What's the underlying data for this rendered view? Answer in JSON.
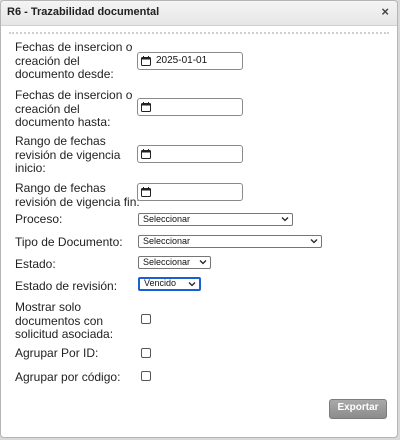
{
  "dialog": {
    "title": "R6 - Trazabilidad documental",
    "close_label": "×"
  },
  "fields": {
    "fecha_desde": {
      "label": "Fechas de insercion o creación del documento desde:",
      "value": "2025-01-01"
    },
    "fecha_hasta": {
      "label": "Fechas de insercion o creación del documento hasta:",
      "value": ""
    },
    "revision_inicio": {
      "label": "Rango de fechas revisión de vigencia inicio:",
      "value": ""
    },
    "revision_fin": {
      "label": "Rango de fechas revisión de vigencia fin:",
      "value": ""
    },
    "proceso": {
      "label": "Proceso:",
      "selected": "Seleccionar"
    },
    "tipo_documento": {
      "label": "Tipo de Documento:",
      "selected": "Seleccionar"
    },
    "estado": {
      "label": "Estado:",
      "selected": "Seleccionar"
    },
    "estado_revision": {
      "label": "Estado de revisión:",
      "selected": "Vencido"
    },
    "solicitud": {
      "label": "Mostrar solo documentos con solicitud asociada:",
      "checked": false
    },
    "agrupar_id": {
      "label": "Agrupar Por ID:",
      "checked": false
    },
    "agrupar_codigo": {
      "label": "Agrupar por código:",
      "checked": false
    }
  },
  "actions": {
    "export_label": "Exportar"
  },
  "icons": {
    "date": "calendar-icon",
    "select": "chevron-down-icon"
  },
  "colors": {
    "focus": "#1a5fd6",
    "button": "#9a9a9a"
  }
}
